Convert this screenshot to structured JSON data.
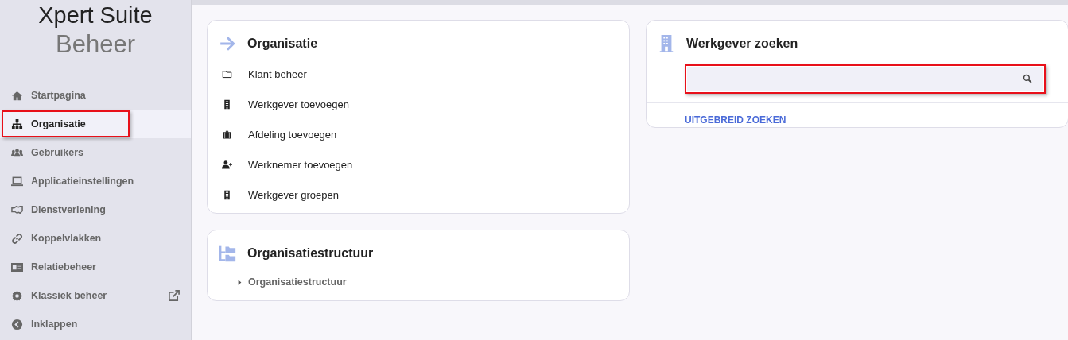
{
  "logo": {
    "title": "Xpert Suite",
    "subtitle": "Beheer"
  },
  "sidebar": {
    "items": [
      {
        "label": "Startpagina",
        "selected": false,
        "highlighted": false,
        "external": false
      },
      {
        "label": "Organisatie",
        "selected": true,
        "highlighted": true,
        "external": false
      },
      {
        "label": "Gebruikers",
        "selected": false,
        "highlighted": false,
        "external": false
      },
      {
        "label": "Applicatieinstellingen",
        "selected": false,
        "highlighted": false,
        "external": false
      },
      {
        "label": "Dienstverlening",
        "selected": false,
        "highlighted": false,
        "external": false
      },
      {
        "label": "Koppelvlakken",
        "selected": false,
        "highlighted": false,
        "external": false
      },
      {
        "label": "Relatiebeheer",
        "selected": false,
        "highlighted": false,
        "external": false
      },
      {
        "label": "Klassiek beheer",
        "selected": false,
        "highlighted": false,
        "external": true
      },
      {
        "label": "Inklappen",
        "selected": false,
        "highlighted": false,
        "external": false
      }
    ]
  },
  "organisatie_card": {
    "title": "Organisatie",
    "links": [
      "Klant beheer",
      "Werkgever toevoegen",
      "Afdeling toevoegen",
      "Werknemer toevoegen",
      "Werkgever groepen"
    ]
  },
  "structuur_card": {
    "title": "Organisatiestructuur",
    "tree": [
      {
        "label": "Organisatiestructuur",
        "expanded": false
      }
    ]
  },
  "search_card": {
    "title": "Werkgever zoeken",
    "search": {
      "highlighted": true
    },
    "advanced_link": "UITGEBREID ZOEKEN"
  }
}
